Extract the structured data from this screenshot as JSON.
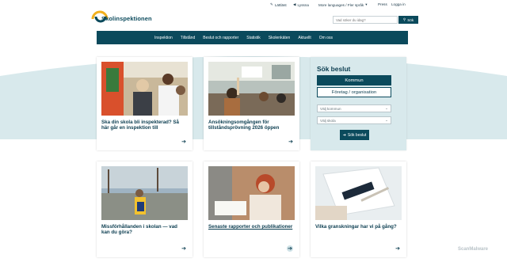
{
  "header": {
    "logo_text": "Skolinspektionen",
    "util_links": [
      {
        "label": "Lättläst",
        "icon": "book-icon"
      },
      {
        "label": "Lyssna",
        "icon": "speaker-icon"
      },
      {
        "label": "More languages / Fler språk",
        "icon": "chevron-down-icon"
      },
      {
        "label": "Press"
      },
      {
        "label": "Logga in"
      }
    ],
    "search": {
      "placeholder": "Vad söker du idag?",
      "button_label": "Sök"
    }
  },
  "nav": {
    "items": [
      "Inspektion",
      "Tillstånd",
      "Beslut och rapporter",
      "Statistik",
      "Skolenkäten",
      "Aktuellt",
      "Om oss"
    ]
  },
  "cards": [
    {
      "title": "Ska din skola bli inspekterad? Så här går en inspektion till"
    },
    {
      "title": "Ansökningsomgången för tillståndsprövning 2026 öppen"
    },
    {
      "title": "Missförhållanden i skolan — vad kan du göra?"
    },
    {
      "title": "Senaste rapporter och publikationer"
    },
    {
      "title": "Vilka granskningar har vi på gång?"
    }
  ],
  "beslut": {
    "heading": "Sök beslut",
    "tabs": [
      "Kommun",
      "Företag / organisation"
    ],
    "select_kommun": "Välj kommun",
    "select_skola": "Välj skola",
    "button_label": "Sök beslut"
  },
  "watermark": "ScanMalware",
  "colors": {
    "brand": "#0b4a5c",
    "band": "#d8e9ec",
    "logo_yellow": "#f2b01e"
  }
}
